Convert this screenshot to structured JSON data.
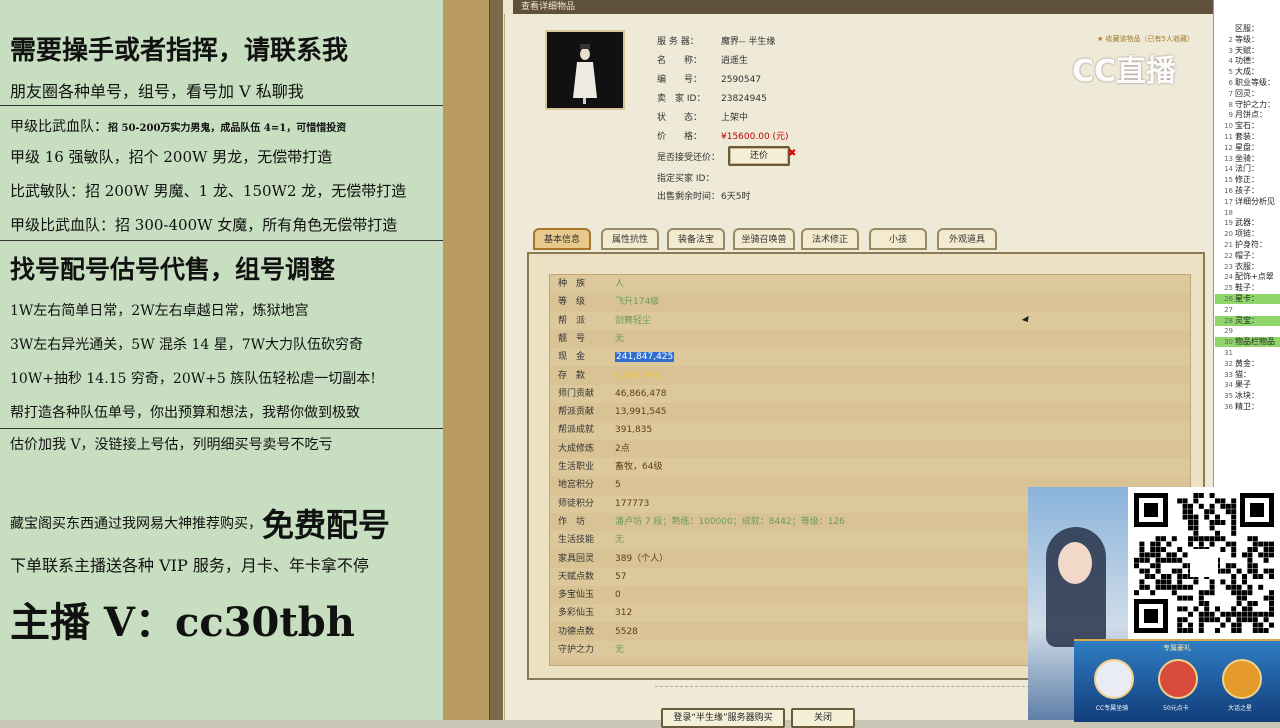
{
  "left_panel": {
    "headline": "需要操手或者指挥，请联系我",
    "friends": "朋友圈各种单号，组号，看号加 V 私聊我",
    "teams": [
      {
        "label": "甲级比武血队：",
        "text": "招 50-200万实力男鬼，成品队伍 4=1，可惜惜投资"
      },
      {
        "label": "甲级 16 强敏队，",
        "text": "招个 200W 男龙，无偿带打造"
      },
      {
        "label": "比武敏队：",
        "text": "招 200W 男魔、1 龙、150W2 龙，无偿带打造"
      },
      {
        "label": "甲级比武血队：",
        "text": "招 300-400W 女魔，所有角色无偿带打造"
      }
    ],
    "headline2": "找号配号估号代售，组号调整",
    "services": [
      "1W左右简单日常，2W左右卓越日常，炼狱地宫",
      "3W左右异光通关，5W 混杀 14 星，7W大力队伍砍穷奇",
      "10W+抽秒 14.15 穷奇，20W+5 族队伍轻松虐一切副本!",
      "帮打造各种队伍单号，你出预算和想法，我帮你做到极致",
      "估价加我 V，没链接上号估，列明细买号卖号不吃亏"
    ],
    "cangbao": "藏宝阁买东西通过我网易大神推荐购买，",
    "free": "免费配号",
    "vip": "下单联系主播送各种 VIP 服务，月卡、年卡拿不停",
    "contact": "主播 V：cc30tbh"
  },
  "window": {
    "title": "查看详细物品",
    "favorite": "收藏该物品（已有5人收藏）",
    "info": [
      {
        "key": "服 务 器：",
        "value": "魔界-- 半生缘"
      },
      {
        "key": "名　　称：",
        "value": "逍遥生"
      },
      {
        "key": "编　　号：",
        "value": "2590547"
      },
      {
        "key": "卖　家 ID：",
        "value": "23824945"
      },
      {
        "key": "状　　态：",
        "value": "上架中"
      },
      {
        "key": "价　　格：",
        "value": "¥15600.00 (元)"
      },
      {
        "key": "是否接受还价：",
        "value": ""
      },
      {
        "key": "指定买家 ID：",
        "value": ""
      },
      {
        "key": "出售剩余时间：",
        "value": "6天5时"
      }
    ],
    "counter_offer_button": "还价",
    "tabs": [
      "基本信息",
      "属性抗性",
      "装备法宝",
      "坐骑召唤兽",
      "法术修正",
      "小孩",
      "外观道具"
    ],
    "stats": [
      {
        "key": "种　族",
        "value": "人",
        "cls": "green"
      },
      {
        "key": "等　级",
        "value": "飞升174级",
        "cls": "green"
      },
      {
        "key": "帮　派",
        "value": "剑舞轻尘",
        "cls": "green"
      },
      {
        "key": "靓　号",
        "value": "无",
        "cls": "green"
      },
      {
        "key": "现　金",
        "value": "241,847,425",
        "cls": "hl"
      },
      {
        "key": "存　款",
        "value": "6,869,006",
        "cls": "yellow"
      },
      {
        "key": "师门贡献",
        "value": "46,866,478",
        "cls": "brown"
      },
      {
        "key": "帮派贡献",
        "value": "13,991,545",
        "cls": "brown"
      },
      {
        "key": "帮派成就",
        "value": "391,835",
        "cls": "brown"
      },
      {
        "key": "大成修炼",
        "value": "2点",
        "cls": "brown"
      },
      {
        "key": "生活职业",
        "value": "畜牧，64级",
        "cls": "brown"
      },
      {
        "key": "地宫积分",
        "value": "5",
        "cls": "brown"
      },
      {
        "key": "师徒积分",
        "value": "177773",
        "cls": "brown"
      },
      {
        "key": "作　坊",
        "value": "潘卢坊 7 段；熟练：100000；成就：8442；等级：126",
        "cls": "green"
      },
      {
        "key": "生活技能",
        "value": "无",
        "cls": "green"
      },
      {
        "key": "家具回灵",
        "value": "389（个人）",
        "cls": "brown"
      },
      {
        "key": "天赋点数",
        "value": "57",
        "cls": "brown"
      },
      {
        "key": "多宝仙玉",
        "value": "0",
        "cls": "brown"
      },
      {
        "key": "多彩仙玉",
        "value": "312",
        "cls": "brown"
      },
      {
        "key": "功德点数",
        "value": "5528",
        "cls": "brown"
      },
      {
        "key": "守护之力",
        "value": "无",
        "cls": "green"
      }
    ],
    "bottom_buttons": [
      "登录“半生缘”服务器购买",
      "关闭"
    ]
  },
  "rightbar": [
    {
      "n": "",
      "t": "区服："
    },
    {
      "n": "2",
      "t": "等级："
    },
    {
      "n": "3",
      "t": "天赋："
    },
    {
      "n": "4",
      "t": "功德："
    },
    {
      "n": "5",
      "t": "大成："
    },
    {
      "n": "6",
      "t": "职业等级："
    },
    {
      "n": "7",
      "t": "回灵："
    },
    {
      "n": "8",
      "t": "守护之力："
    },
    {
      "n": "9",
      "t": "月饼点："
    },
    {
      "n": "10",
      "t": "宝石："
    },
    {
      "n": "11",
      "t": "套装："
    },
    {
      "n": "12",
      "t": "星盘："
    },
    {
      "n": "13",
      "t": "坐骑："
    },
    {
      "n": "14",
      "t": "法门："
    },
    {
      "n": "15",
      "t": "修正："
    },
    {
      "n": "16",
      "t": "孩子："
    },
    {
      "n": "17",
      "t": "详细分析见"
    },
    {
      "n": "18",
      "t": ""
    },
    {
      "n": "19",
      "t": "武器："
    },
    {
      "n": "20",
      "t": "项链："
    },
    {
      "n": "21",
      "t": "护身符："
    },
    {
      "n": "22",
      "t": "帽子："
    },
    {
      "n": "23",
      "t": "衣服："
    },
    {
      "n": "24",
      "t": "配饰+点翠"
    },
    {
      "n": "25",
      "t": "鞋子："
    },
    {
      "n": "26",
      "t": "星卡：",
      "g": true
    },
    {
      "n": "27",
      "t": ""
    },
    {
      "n": "28",
      "t": "灵宝：",
      "g": true
    },
    {
      "n": "29",
      "t": ""
    },
    {
      "n": "30",
      "t": "物品栏物品",
      "g": true
    },
    {
      "n": "31",
      "t": ""
    },
    {
      "n": "32",
      "t": "黄金："
    },
    {
      "n": "33",
      "t": "猫："
    },
    {
      "n": "34",
      "t": "果子"
    },
    {
      "n": "35",
      "t": "冰块："
    },
    {
      "n": "36",
      "t": "精卫："
    }
  ],
  "watermark": "CC直播",
  "ad": {
    "title": "专属豪礼",
    "items": [
      "CC专属坐骑",
      "50元点卡",
      "大话之星"
    ]
  }
}
